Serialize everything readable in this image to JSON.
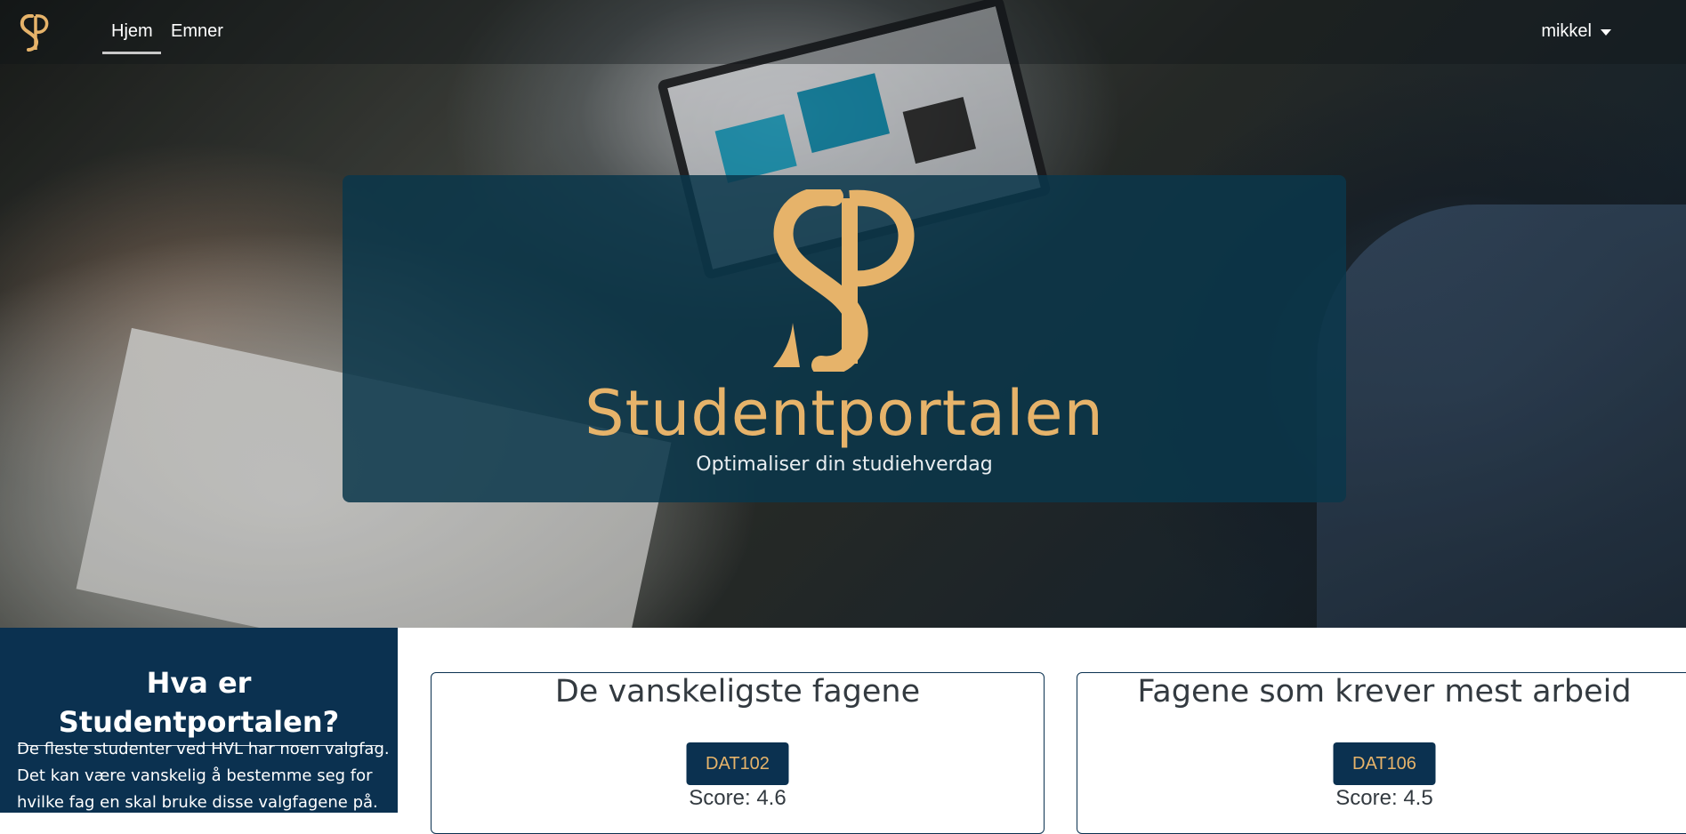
{
  "navbar": {
    "logo": "sp-monogram-logo",
    "links": {
      "home": "Hjem",
      "topics": "Emner"
    },
    "active": "home",
    "user": "mikkel"
  },
  "hero": {
    "title": "Studentportalen",
    "tagline": "Optimaliser din studiehverdag",
    "accent_color": "#e6b36a",
    "card_color": "#0a374b"
  },
  "info": {
    "heading": "Hva er Studentportalen?",
    "text": "De fleste studenter ved HVL har noen valgfag. Det kan være vanskelig å bestemme seg for hvilke fag en skal bruke disse valgfagene på."
  },
  "cards": {
    "hardest": {
      "title": "De vanskeligste fagene",
      "course": "DAT102",
      "score": "Score: 4.6"
    },
    "most_work": {
      "title": "Fagene som krever mest arbeid",
      "course": "DAT106",
      "score": "Score: 4.5"
    }
  },
  "colors": {
    "navy": "#0b3150",
    "gold": "#e6b36a"
  }
}
